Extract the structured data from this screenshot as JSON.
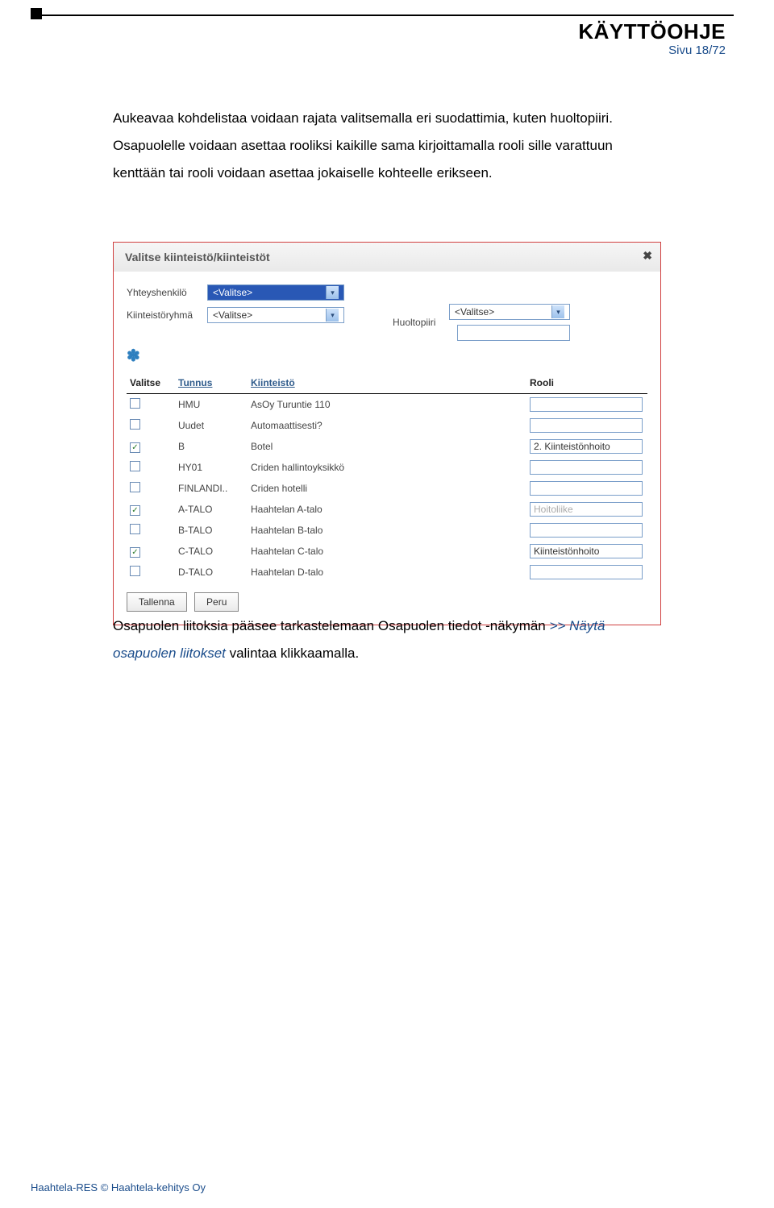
{
  "header": {
    "title": "KÄYTTÖOHJE",
    "page": "Sivu 18/72"
  },
  "para1": "Aukeavaa kohdelistaa voidaan rajata valitsemalla eri suodattimia, kuten huoltopiiri. Osapuolelle voidaan asettaa rooliksi kaikille sama kirjoittamalla rooli sille varattuun kenttään tai rooli voidaan asettaa jokaiselle kohteelle erikseen.",
  "para2_a": "Osapuolen liitoksia pääsee tarkastelemaan Osapuolen tiedot -näkymän ",
  "para2_link": ">> Näytä osapuolen liitokset",
  "para2_b": " valintaa klikkaamalla.",
  "screenshot": {
    "dialog_title": "Valitse kiinteistö/kiinteistöt",
    "close": "✖",
    "labels": {
      "yhteyshenkilo": "Yhteyshenkilö",
      "kiinteistoryhma": "Kiinteistöryhmä",
      "huoltopiiri": "Huoltopiiri"
    },
    "select_placeholder": "<Valitse>",
    "columns": {
      "valitse": "Valitse",
      "tunnus": "Tunnus",
      "kiinteisto": "Kiinteistö",
      "rooli": "Rooli"
    },
    "rows": [
      {
        "checked": false,
        "tunnus": "HMU",
        "kiinteisto": "AsOy Turuntie 110",
        "rooli": ""
      },
      {
        "checked": false,
        "tunnus": "Uudet",
        "kiinteisto": "Automaattisesti?",
        "rooli": ""
      },
      {
        "checked": true,
        "tunnus": "B",
        "kiinteisto": "Botel",
        "rooli": "2. Kiinteistönhoito"
      },
      {
        "checked": false,
        "tunnus": "HY01",
        "kiinteisto": "Criden hallintoyksikkö",
        "rooli": ""
      },
      {
        "checked": false,
        "tunnus": "FINLANDI..",
        "kiinteisto": "Criden hotelli",
        "rooli": ""
      },
      {
        "checked": true,
        "tunnus": "A-TALO",
        "kiinteisto": "Haahtelan A-talo",
        "rooli": "Hoitoliike",
        "disabled": true
      },
      {
        "checked": false,
        "tunnus": "B-TALO",
        "kiinteisto": "Haahtelan B-talo",
        "rooli": ""
      },
      {
        "checked": true,
        "tunnus": "C-TALO",
        "kiinteisto": "Haahtelan C-talo",
        "rooli": "Kiinteistönhoito"
      },
      {
        "checked": false,
        "tunnus": "D-TALO",
        "kiinteisto": "Haahtelan D-talo",
        "rooli": ""
      }
    ],
    "buttons": {
      "save": "Tallenna",
      "cancel": "Peru"
    }
  },
  "footer": "Haahtela-RES © Haahtela-kehitys Oy"
}
